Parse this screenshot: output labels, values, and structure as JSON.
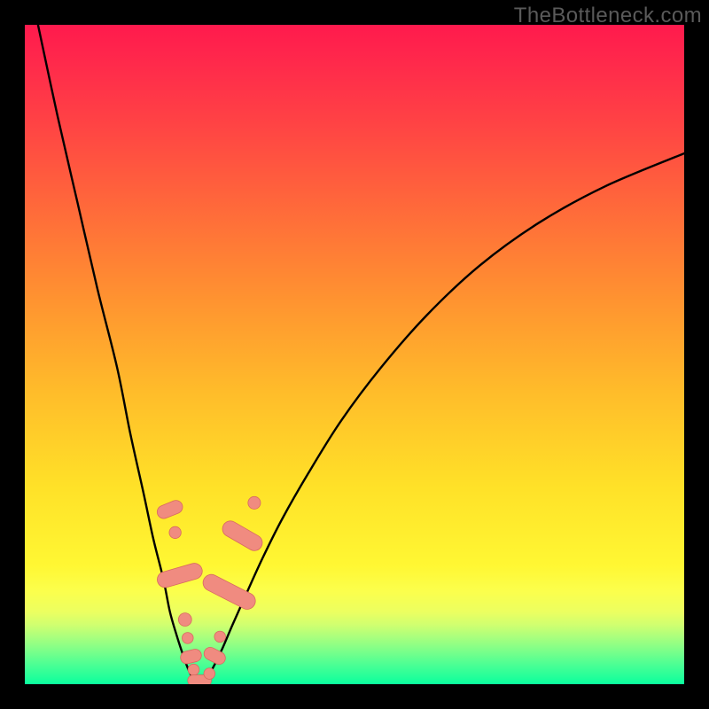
{
  "watermark": {
    "text": "TheBottleneck.com"
  },
  "colors": {
    "background": "#000000",
    "curve": "#000000",
    "marker_fill": "#f08b80",
    "marker_stroke": "#d86a60",
    "gradient_stops": [
      "#ff1a4d",
      "#ff2a4b",
      "#ff4045",
      "#ff6a3a",
      "#ff9430",
      "#ffbd2a",
      "#ffe128",
      "#fff733",
      "#fbff4d",
      "#ecff60",
      "#d0ff70",
      "#a6ff7e",
      "#7aff8a",
      "#4cff94",
      "#21ff9a",
      "#0aff9e"
    ]
  },
  "chart_data": {
    "type": "line",
    "title": "",
    "xlabel": "",
    "ylabel": "",
    "xlim": [
      0,
      100
    ],
    "ylim": [
      0,
      100
    ],
    "series": [
      {
        "name": "left-branch",
        "x": [
          2,
          5,
          8,
          11,
          14,
          16,
          18,
          19.5,
          21,
          22,
          23,
          23.8,
          24.5,
          25,
          25.5,
          26
        ],
        "y": [
          100,
          86,
          73,
          60,
          48,
          38,
          29,
          22,
          16,
          11,
          7.5,
          5,
          3,
          1.8,
          0.9,
          0.3
        ]
      },
      {
        "name": "right-branch",
        "x": [
          27,
          27.8,
          28.8,
          30,
          31.5,
          33.5,
          36,
          39,
          43,
          48,
          54,
          61,
          69,
          78,
          88,
          100
        ],
        "y": [
          0.3,
          1.2,
          3,
          5.5,
          9,
          13.5,
          19,
          25,
          32,
          40,
          48,
          56,
          63.5,
          70,
          75.5,
          80.5
        ]
      }
    ],
    "markers": [
      {
        "name": "left-cluster",
        "shape": "capsule",
        "cx": 22.0,
        "cy": 26.5,
        "rx": 1.0,
        "ry": 2.0,
        "angle": 68
      },
      {
        "name": "left-cluster",
        "shape": "circle",
        "cx": 22.8,
        "cy": 23.0,
        "r": 0.9
      },
      {
        "name": "left-cluster",
        "shape": "capsule",
        "cx": 23.5,
        "cy": 16.5,
        "rx": 1.2,
        "ry": 3.5,
        "angle": 74
      },
      {
        "name": "left-cluster",
        "shape": "circle",
        "cx": 24.3,
        "cy": 9.8,
        "r": 1.0
      },
      {
        "name": "left-cluster",
        "shape": "circle",
        "cx": 24.7,
        "cy": 7.0,
        "r": 0.85
      },
      {
        "name": "left-cluster",
        "shape": "capsule",
        "cx": 25.2,
        "cy": 4.2,
        "rx": 0.95,
        "ry": 1.6,
        "angle": 76
      },
      {
        "name": "left-cluster",
        "shape": "circle",
        "cx": 25.6,
        "cy": 2.2,
        "r": 0.85
      },
      {
        "name": "bottom",
        "shape": "capsule",
        "cx": 26.5,
        "cy": 0.55,
        "rx": 1.8,
        "ry": 0.85,
        "angle": 0
      },
      {
        "name": "right-cluster",
        "shape": "circle",
        "cx": 28.0,
        "cy": 1.6,
        "r": 0.85
      },
      {
        "name": "right-cluster",
        "shape": "capsule",
        "cx": 28.8,
        "cy": 4.3,
        "rx": 0.95,
        "ry": 1.7,
        "angle": -63
      },
      {
        "name": "right-cluster",
        "shape": "circle",
        "cx": 29.6,
        "cy": 7.2,
        "r": 0.85
      },
      {
        "name": "right-cluster",
        "shape": "capsule",
        "cx": 31.0,
        "cy": 14.0,
        "rx": 1.25,
        "ry": 4.3,
        "angle": -63
      },
      {
        "name": "right-cluster",
        "shape": "capsule",
        "cx": 33.0,
        "cy": 22.5,
        "rx": 1.2,
        "ry": 3.3,
        "angle": -60
      },
      {
        "name": "right-cluster",
        "shape": "circle",
        "cx": 34.8,
        "cy": 27.5,
        "r": 0.95
      }
    ]
  }
}
